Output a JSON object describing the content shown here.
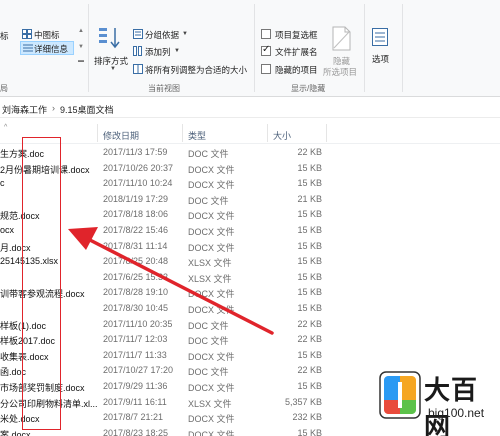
{
  "ribbon": {
    "layout": {
      "label_left": "标",
      "medium_icons": "中图标",
      "details": "详细信息",
      "group_label": "局"
    },
    "current_view": {
      "sort_by": "排序方式",
      "group_by": "分组依据",
      "add_columns": "添加列",
      "size_all_columns": "将所有列调整为合适的大小",
      "group_label": "当前视图"
    },
    "show_hide": {
      "item_check_boxes": "项目复选框",
      "file_name_extensions": "文件扩展名",
      "hidden_items": "隐藏的项目",
      "hide_selected_line1": "隐藏",
      "hide_selected_line2": "所选项目",
      "options": "选项",
      "group_label": "显示/隐藏",
      "item_check_boxes_checked": false,
      "file_name_extensions_checked": true,
      "hidden_items_checked": false
    }
  },
  "address": {
    "part1": "刘海森工作",
    "sep": "›",
    "part2": "9.15桌面文档"
  },
  "columns": {
    "date": "修改日期",
    "type": "类型",
    "size": "大小"
  },
  "files": [
    {
      "name": "生方案.doc",
      "date": "2017/11/3 17:59",
      "type": "DOC 文件",
      "size": "22 KB"
    },
    {
      "name": "2月份暑期培训课.docx",
      "date": "2017/10/26 20:37",
      "type": "DOCX 文件",
      "size": "15 KB"
    },
    {
      "name": "c",
      "date": "2017/11/10 10:24",
      "type": "DOCX 文件",
      "size": "15 KB"
    },
    {
      "name": "",
      "date": "2018/1/19 17:29",
      "type": "DOC 文件",
      "size": "21 KB"
    },
    {
      "name": "规范.docx",
      "date": "2017/8/18 18:06",
      "type": "DOCX 文件",
      "size": "15 KB"
    },
    {
      "name": "ocx",
      "date": "2017/8/22 15:46",
      "type": "DOCX 文件",
      "size": "15 KB"
    },
    {
      "name": "月.docx",
      "date": "2017/8/31 11:14",
      "type": "DOCX 文件",
      "size": "15 KB"
    },
    {
      "name": "25145135.xlsx",
      "date": "2017/8/25 20:48",
      "type": "XLSX 文件",
      "size": "15 KB"
    },
    {
      "name": "",
      "date": "2017/6/25 15:33",
      "type": "XLSX 文件",
      "size": "15 KB"
    },
    {
      "name": "训带客参观流程.docx",
      "date": "2017/8/28 19:10",
      "type": "DOCX 文件",
      "size": "15 KB"
    },
    {
      "name": "",
      "date": "2017/8/30 10:45",
      "type": "DOCX 文件",
      "size": "15 KB"
    },
    {
      "name": "样板(1).doc",
      "date": "2017/11/10 20:35",
      "type": "DOC 文件",
      "size": "22 KB"
    },
    {
      "name": "样板2017.doc",
      "date": "2017/11/7 12:03",
      "type": "DOC 文件",
      "size": "22 KB"
    },
    {
      "name": "收集表.docx",
      "date": "2017/11/7 11:33",
      "type": "DOCX 文件",
      "size": "15 KB"
    },
    {
      "name": "函.doc",
      "date": "2017/10/27 17:20",
      "type": "DOC 文件",
      "size": "22 KB"
    },
    {
      "name": "市场部奖罚制度.docx",
      "date": "2017/9/29 11:36",
      "type": "DOCX 文件",
      "size": "15 KB"
    },
    {
      "name": "分公司印刷物料清单.xl...",
      "date": "2017/9/11 16:11",
      "type": "XLSX 文件",
      "size": "5,357 KB"
    },
    {
      "name": "米处.docx",
      "date": "2017/8/7 21:21",
      "type": "DOCX 文件",
      "size": "232 KB"
    },
    {
      "name": "案.docx",
      "date": "2017/8/23 18:25",
      "type": "DOCX 文件",
      "size": "15 KB"
    }
  ],
  "watermark": {
    "title": "大百网",
    "url": "big100.net"
  },
  "colors": {
    "annotation_red": "#e0242b",
    "ribbon_bg": "#f8f9fa",
    "header_text": "#4c607a",
    "selected_bg": "#cce8ff"
  }
}
